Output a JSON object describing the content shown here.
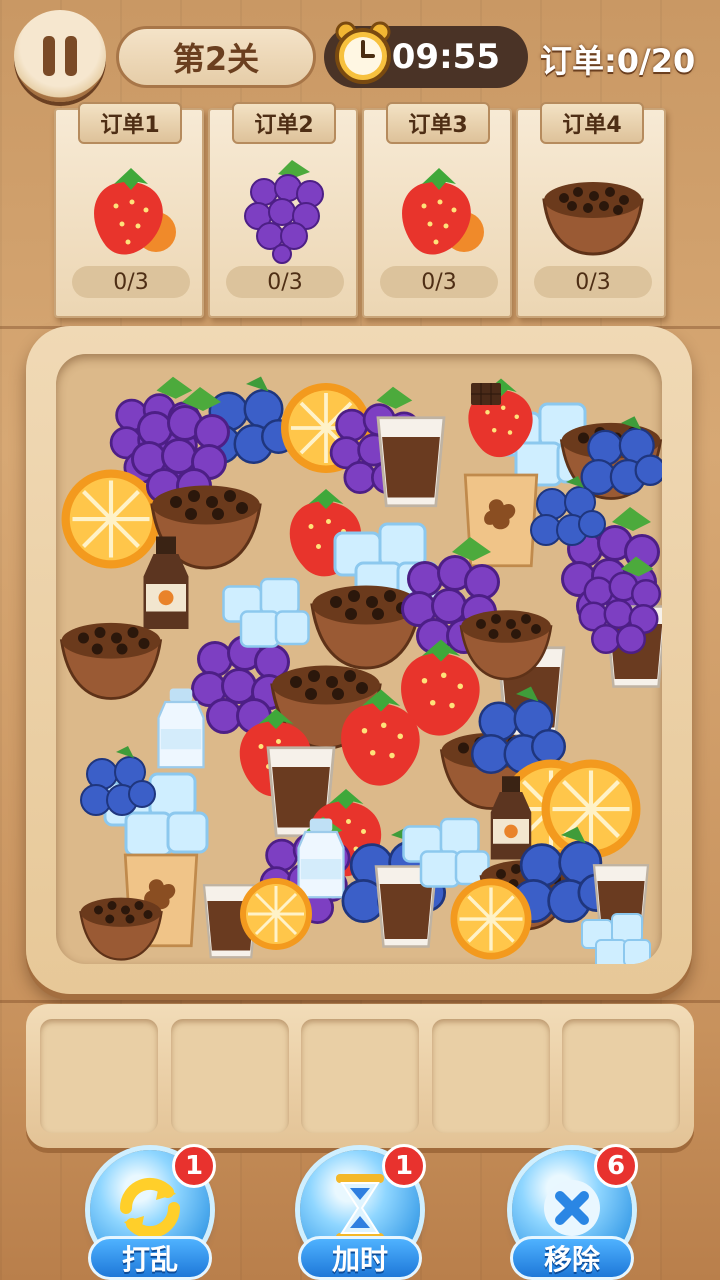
{
  "top_bar": {
    "level_label": "第2关",
    "timer": "09:55",
    "orders_progress": "订单:0/20"
  },
  "orders": [
    {
      "label": "订单1",
      "item": "strawberry-icon",
      "progress": "0/3"
    },
    {
      "label": "订单2",
      "item": "grapes-icon",
      "progress": "0/3"
    },
    {
      "label": "订单3",
      "item": "strawberry-icon",
      "progress": "0/3"
    },
    {
      "label": "订单4",
      "item": "coffee-beans-bowl-icon",
      "progress": "0/3"
    }
  ],
  "tray_items": [
    "grapes",
    "blueberries",
    "orange-slice",
    "ice-cubes",
    "coffee-beans-bowl",
    "coffee-cup",
    "strawberry",
    "milk-bottle",
    "syrup-bottle",
    "latte-cup",
    "chocolate"
  ],
  "slots": {
    "count": 5
  },
  "tools": [
    {
      "label": "打乱",
      "badge": "1",
      "icon": "shuffle-icon"
    },
    {
      "label": "加时",
      "badge": "1",
      "icon": "hourglass-icon"
    },
    {
      "label": "移除",
      "badge": "6",
      "icon": "remove-x-icon"
    }
  ],
  "colors": {
    "wood": "#c99864",
    "timer_bg": "#4a3326",
    "tool_blue": "#3a9de8",
    "badge_red": "#e8322e"
  }
}
